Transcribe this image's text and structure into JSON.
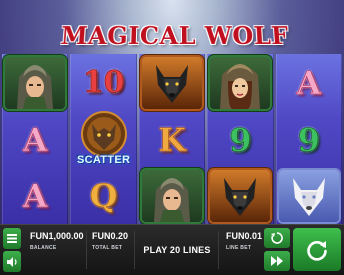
{
  "game": {
    "title": "MAGICAL WOLF"
  },
  "reels": [
    [
      "hunter-wolf-hood",
      "A",
      "A"
    ],
    [
      "10",
      "scatter",
      "Q"
    ],
    [
      "black-wolf",
      "K",
      "hunter-wolf-hood"
    ],
    [
      "woman-wolf-hood",
      "9",
      "black-wolf"
    ],
    [
      "A",
      "9",
      "white-wolf"
    ]
  ],
  "scatter": {
    "label": "SCATTER"
  },
  "bar": {
    "balance_value": "FUN1,000.00",
    "balance_label": "BALANCE",
    "total_bet_value": "FUN0.20",
    "total_bet_label": "TOTAL BET",
    "play_label": "PLAY 20 LINES",
    "line_bet_value": "FUN0.01",
    "line_bet_label": "LINE BET"
  },
  "icons": {
    "menu": "menu-icon",
    "sound": "speaker-icon",
    "autoplay": "autoplay-icon",
    "turbo": "fast-forward-icon",
    "spin": "spin-arrow-icon"
  },
  "colors": {
    "reel_background": "#4f47c4",
    "button_green": "#2e9a3a",
    "title_red": "#c01020"
  }
}
